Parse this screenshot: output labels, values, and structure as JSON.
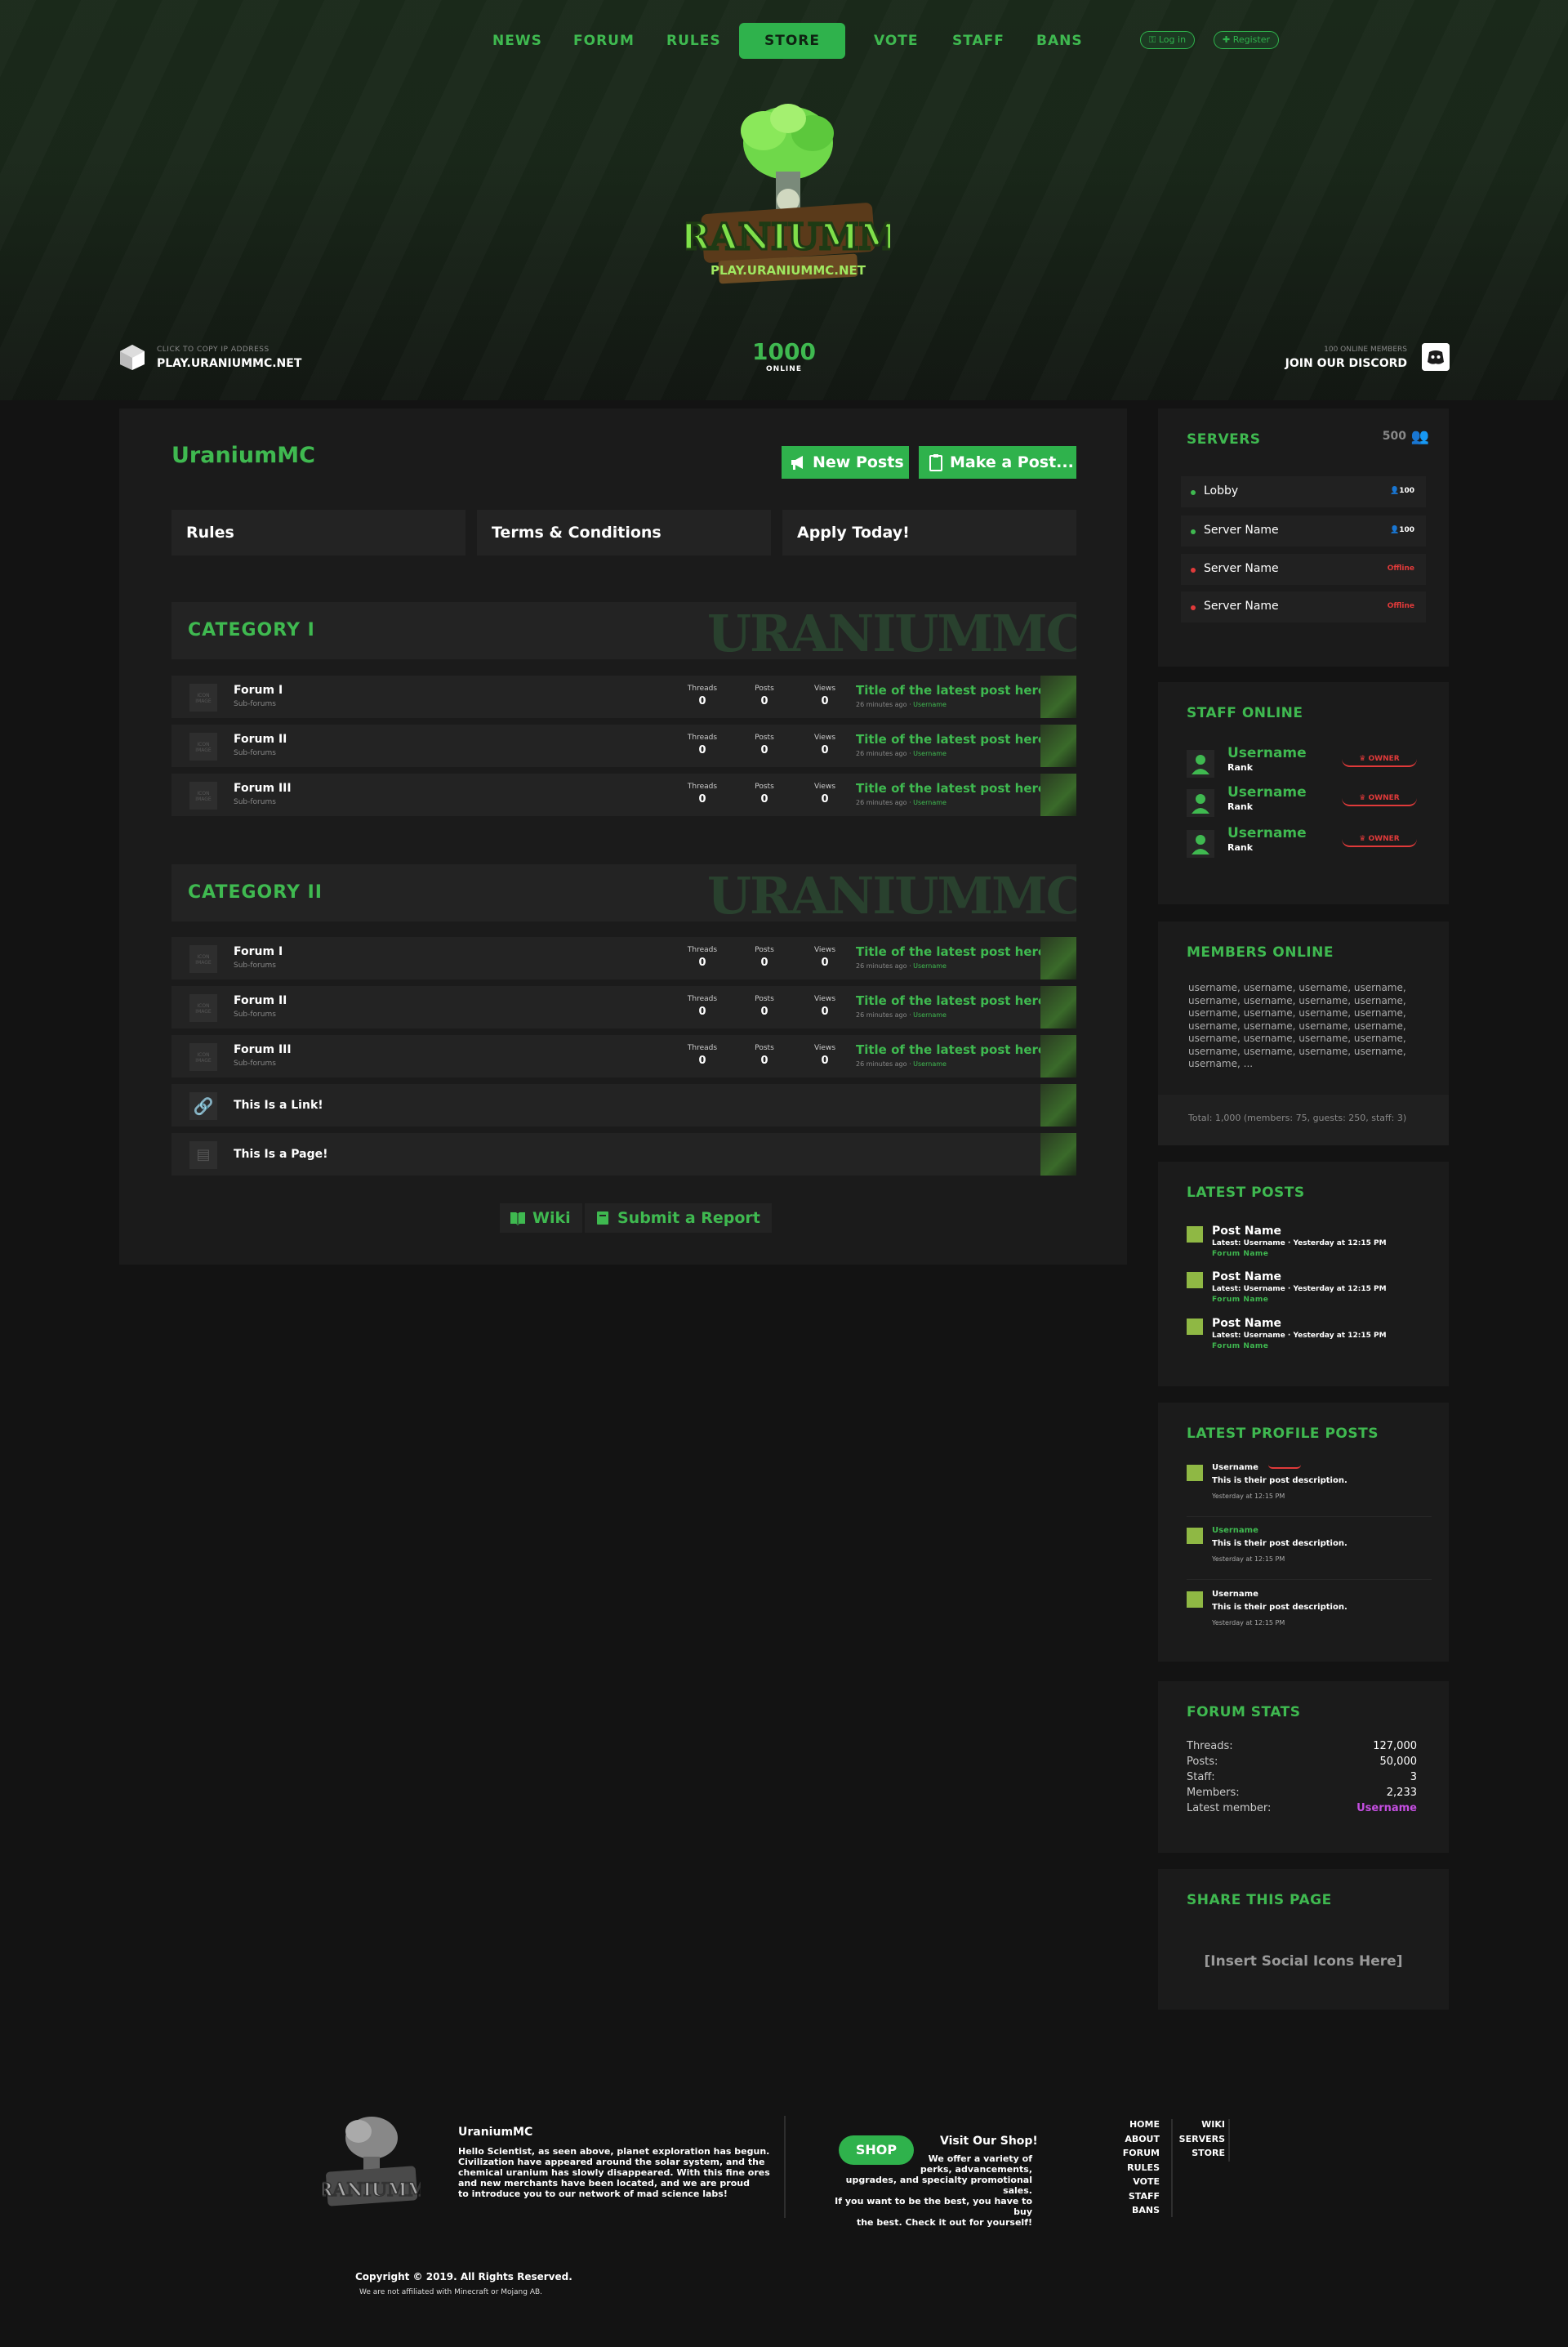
{
  "nav": {
    "items": [
      "NEWS",
      "FORUM",
      "RULES",
      "STORE",
      "VOTE",
      "STAFF",
      "BANS"
    ],
    "login": "Log in",
    "register": "Register"
  },
  "header": {
    "ip_hint": "CLICK TO COPY IP ADDRESS",
    "ip": "PLAY.URANIUMMC.NET",
    "online_count": "1000",
    "online_label": "ONLINE",
    "discord_hint": "100 ONLINE MEMBERS",
    "discord_label": "JOIN OUR DISCORD",
    "logo_text": "URANIUMMC",
    "logo_sub": "PLAY.URANIUMMC.NET"
  },
  "main": {
    "title": "UraniumMC",
    "new_posts": "New Posts",
    "make_post": "Make a Post...",
    "top_links": [
      "Rules",
      "Terms & Conditions",
      "Apply Today!"
    ],
    "watermark": "URANIUMMC",
    "categories": [
      {
        "name": "CATEGORY I",
        "forums": [
          {
            "name": "Forum I",
            "sub": "Sub-forums",
            "threads": "0",
            "posts": "0",
            "views": "0",
            "latest": "Title of the latest post here et...",
            "ago": "26 minutes ago · ",
            "user": "Username"
          },
          {
            "name": "Forum II",
            "sub": "Sub-forums",
            "threads": "0",
            "posts": "0",
            "views": "0",
            "latest": "Title of the latest post here et...",
            "ago": "26 minutes ago · ",
            "user": "Username"
          },
          {
            "name": "Forum III",
            "sub": "Sub-forums",
            "threads": "0",
            "posts": "0",
            "views": "0",
            "latest": "Title of the latest post here et...",
            "ago": "26 minutes ago · ",
            "user": "Username"
          }
        ]
      },
      {
        "name": "CATEGORY II",
        "forums": [
          {
            "name": "Forum I",
            "sub": "Sub-forums",
            "threads": "0",
            "posts": "0",
            "views": "0",
            "latest": "Title of the latest post here et...",
            "ago": "26 minutes ago · ",
            "user": "Username"
          },
          {
            "name": "Forum II",
            "sub": "Sub-forums",
            "threads": "0",
            "posts": "0",
            "views": "0",
            "latest": "Title of the latest post here et...",
            "ago": "26 minutes ago · ",
            "user": "Username"
          },
          {
            "name": "Forum III",
            "sub": "Sub-forums",
            "threads": "0",
            "posts": "0",
            "views": "0",
            "latest": "Title of the latest post here et...",
            "ago": "26 minutes ago · ",
            "user": "Username"
          }
        ]
      }
    ],
    "stat_labels": [
      "Threads",
      "Posts",
      "Views"
    ],
    "icon_placeholder": "ICON IMAGE",
    "link_row": "This Is a Link!",
    "page_row": "This Is a Page!",
    "wiki": "Wiki",
    "report": "Submit a Report"
  },
  "sidebar": {
    "servers": {
      "title": "SERVERS",
      "total": "500",
      "list": [
        {
          "name": "Lobby",
          "count": "100",
          "status": "online"
        },
        {
          "name": "Server Name",
          "count": "100",
          "status": "online"
        },
        {
          "name": "Server Name",
          "count": "Offline",
          "status": "offline"
        },
        {
          "name": "Server Name",
          "count": "Offline",
          "status": "offline"
        }
      ]
    },
    "staff": {
      "title": "STAFF ONLINE",
      "list": [
        {
          "user": "Username",
          "rank": "Rank",
          "badge": "OWNER"
        },
        {
          "user": "Username",
          "rank": "Rank",
          "badge": "OWNER"
        },
        {
          "user": "Username",
          "rank": "Rank",
          "badge": "OWNER"
        }
      ]
    },
    "members": {
      "title": "MEMBERS ONLINE",
      "lines": [
        "username, username, username, username,",
        "username, username, username, username,",
        "username, username, username, username,",
        "username, username, username, username,",
        "username, username, username, username,",
        "username, username, username, username,",
        "username, ..."
      ],
      "totals": "Total: 1,000 (members: 75, guests: 250, staff: 3)"
    },
    "latest_posts": {
      "title": "LATEST POSTS",
      "list": [
        {
          "name": "Post Name",
          "meta": "Latest: Username · Yesterday at 12:15 PM",
          "forum": "Forum Name"
        },
        {
          "name": "Post Name",
          "meta": "Latest: Username · Yesterday at 12:15 PM",
          "forum": "Forum Name"
        },
        {
          "name": "Post Name",
          "meta": "Latest: Username · Yesterday at 12:15 PM",
          "forum": "Forum Name"
        }
      ]
    },
    "profile_posts": {
      "title": "LATEST PROFILE POSTS",
      "list": [
        {
          "user": "Username",
          "desc": "This is their post description.",
          "time": "Yesterday at 12:15 PM"
        },
        {
          "user": "Username",
          "desc": "This is their post description.",
          "time": "Yesterday at 12:15 PM"
        },
        {
          "user": "Username",
          "desc": "This is their post description.",
          "time": "Yesterday at 12:15 PM"
        }
      ]
    },
    "forum_stats": {
      "title": "FORUM STATS",
      "rows": [
        {
          "label": "Threads:",
          "value": "127,000"
        },
        {
          "label": "Posts:",
          "value": "50,000"
        },
        {
          "label": "Staff:",
          "value": "3"
        },
        {
          "label": "Members:",
          "value": "2,233"
        },
        {
          "label": "Latest member:",
          "value": "Username"
        }
      ]
    },
    "share": {
      "title": "SHARE THIS PAGE",
      "placeholder": "[Insert Social Icons Here]"
    }
  },
  "footer": {
    "name": "UraniumMC",
    "about": [
      "Hello Scientist, as seen above, planet exploration has begun.",
      "Civilization have appeared around the solar system, and the",
      "chemical uranium has slowly disappeared. With this fine ores",
      "and new merchants have been located, and we are proud",
      "to introduce you to our network of mad science labs!"
    ],
    "shop_button": "SHOP",
    "shop_title": "Visit Our Shop!",
    "shop_text": [
      "We offer a variety of",
      "perks, advancements,",
      "upgrades, and specialty promotional sales.",
      "If you want to be the best, you have to buy",
      "the best. Check it out for yourself!"
    ],
    "links_col1": [
      "HOME",
      "ABOUT",
      "FORUM",
      "RULES",
      "VOTE",
      "STAFF",
      "BANS"
    ],
    "links_col2": [
      "WIKI",
      "SERVERS",
      "STORE"
    ],
    "copyright": "Copyright © 2019. All Rights Reserved.",
    "disclaimer": "We are not affiliated with Minecraft or Mojang AB."
  }
}
